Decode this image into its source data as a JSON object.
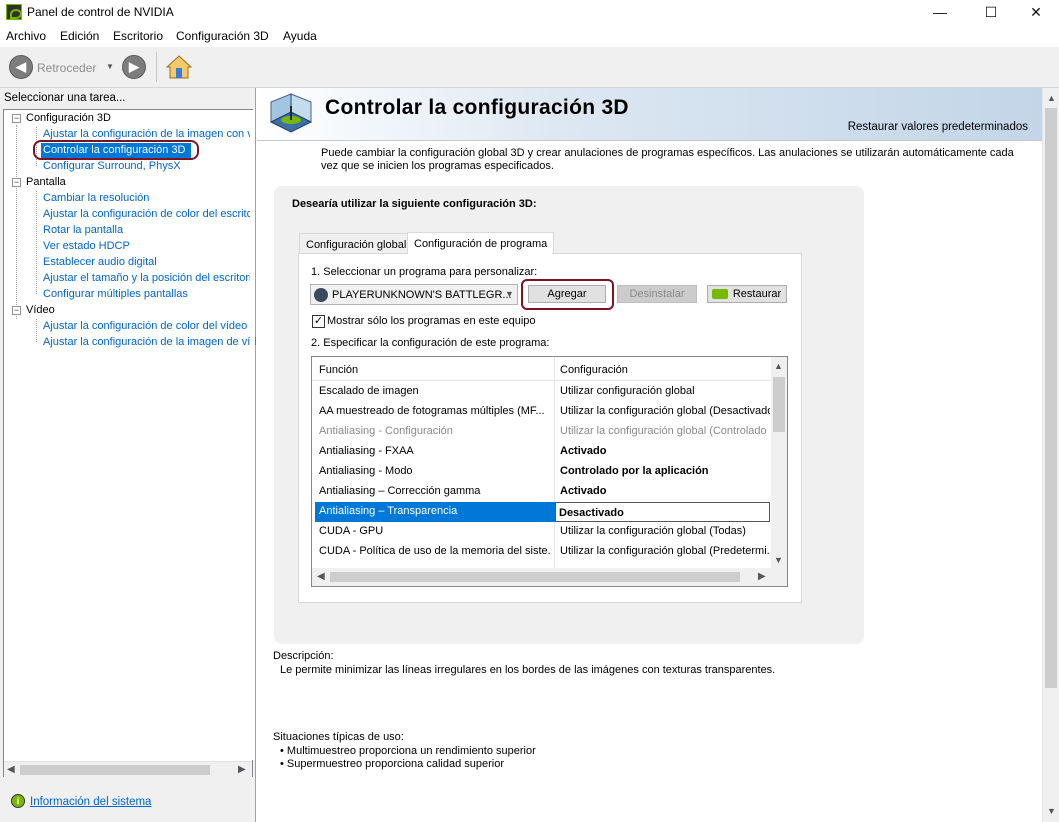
{
  "window": {
    "title": "Panel de control de NVIDIA",
    "minimize": "—",
    "maximize": "☐",
    "close": "✕"
  },
  "menu": [
    "Archivo",
    "Edición",
    "Escritorio",
    "Configuración 3D",
    "Ayuda"
  ],
  "toolbar": {
    "back_label": "Retroceder",
    "back_icon": "◀",
    "forward_icon": "▶",
    "dropdown": "▼"
  },
  "left": {
    "task_label": "Seleccionar una tarea...",
    "tree": [
      {
        "label": "Configuración 3D",
        "type": "category",
        "expand": "−"
      },
      {
        "label": "Ajustar la configuración de la imagen con v",
        "type": "item"
      },
      {
        "label": "Controlar la configuración 3D",
        "type": "item",
        "selected": true
      },
      {
        "label": "Configurar Surround, PhysX",
        "type": "item"
      },
      {
        "label": "Pantalla",
        "type": "category",
        "expand": "−"
      },
      {
        "label": "Cambiar la resolución",
        "type": "item"
      },
      {
        "label": "Ajustar la configuración de color del escrito",
        "type": "item"
      },
      {
        "label": "Rotar la pantalla",
        "type": "item"
      },
      {
        "label": "Ver estado HDCP",
        "type": "item"
      },
      {
        "label": "Establecer audio digital",
        "type": "item"
      },
      {
        "label": "Ajustar el tamaño y la posición del escritori",
        "type": "item"
      },
      {
        "label": "Configurar múltiples pantallas",
        "type": "item"
      },
      {
        "label": "Vídeo",
        "type": "category",
        "expand": "−"
      },
      {
        "label": "Ajustar la configuración de color del vídeo",
        "type": "item"
      },
      {
        "label": "Ajustar la configuración de la imagen de víd",
        "type": "item"
      }
    ],
    "system_info": "Información del sistema"
  },
  "header": {
    "title": "Controlar la configuración 3D",
    "restore": "Restaurar valores predeterminados"
  },
  "intro": "Puede cambiar la configuración global 3D y crear anulaciones de programas específicos. Las anulaciones se utilizarán automáticamente cada vez que se inicien los programas especificados.",
  "panel": {
    "question": "Desearía utilizar la siguiente configuración 3D:",
    "tabs": [
      "Configuración global",
      "Configuración de programa"
    ],
    "step1": "1. Seleccionar un programa para personalizar:",
    "program": "PLAYERUNKNOWN'S BATTLEGR...",
    "add": "Agregar",
    "uninstall": "Desinstalar",
    "restore": "Restaurar",
    "show_only": "Mostrar sólo los programas en este equipo",
    "show_only_checked": true,
    "step2": "2. Especificar la configuración de este programa:",
    "col_function": "Función",
    "col_setting": "Configuración",
    "rows": [
      {
        "f": "Escalado de imagen",
        "s": "Utilizar configuración global"
      },
      {
        "f": "AA muestreado de fotogramas múltiples (MF...",
        "s": "Utilizar la configuración global (Desactivado)"
      },
      {
        "f": "Antialiasing - Configuración",
        "s": "Utilizar la configuración global (Controlado ...",
        "disabled": true
      },
      {
        "f": "Antialiasing - FXAA",
        "s": "Activado",
        "bold": true
      },
      {
        "f": "Antialiasing - Modo",
        "s": "Controlado por la aplicación",
        "bold": true
      },
      {
        "f": "Antialiasing – Corrección gamma",
        "s": "Activado",
        "bold": true
      },
      {
        "f": "Antialiasing – Transparencia",
        "s": "Desactivado",
        "bold": true,
        "selected": true
      },
      {
        "f": "CUDA - GPU",
        "s": "Utilizar la configuración global (Todas)"
      },
      {
        "f": "CUDA - Política de uso de la memoria del siste...",
        "s": "Utilizar la configuración global (Predetermi..."
      }
    ]
  },
  "description": {
    "label": "Descripción:",
    "text": "Le permite minimizar las líneas irregulares en los bordes de las imágenes con texturas transparentes."
  },
  "usage": {
    "label": "Situaciones típicas de uso:",
    "items": [
      "Multimuestreo proporciona un rendimiento superior",
      "Supermuestreo proporciona calidad superior"
    ]
  },
  "colors": {
    "accent": "#76b900",
    "selection": "#0078d7",
    "highlight_ring": "#7a1423",
    "link": "#0066cc"
  }
}
